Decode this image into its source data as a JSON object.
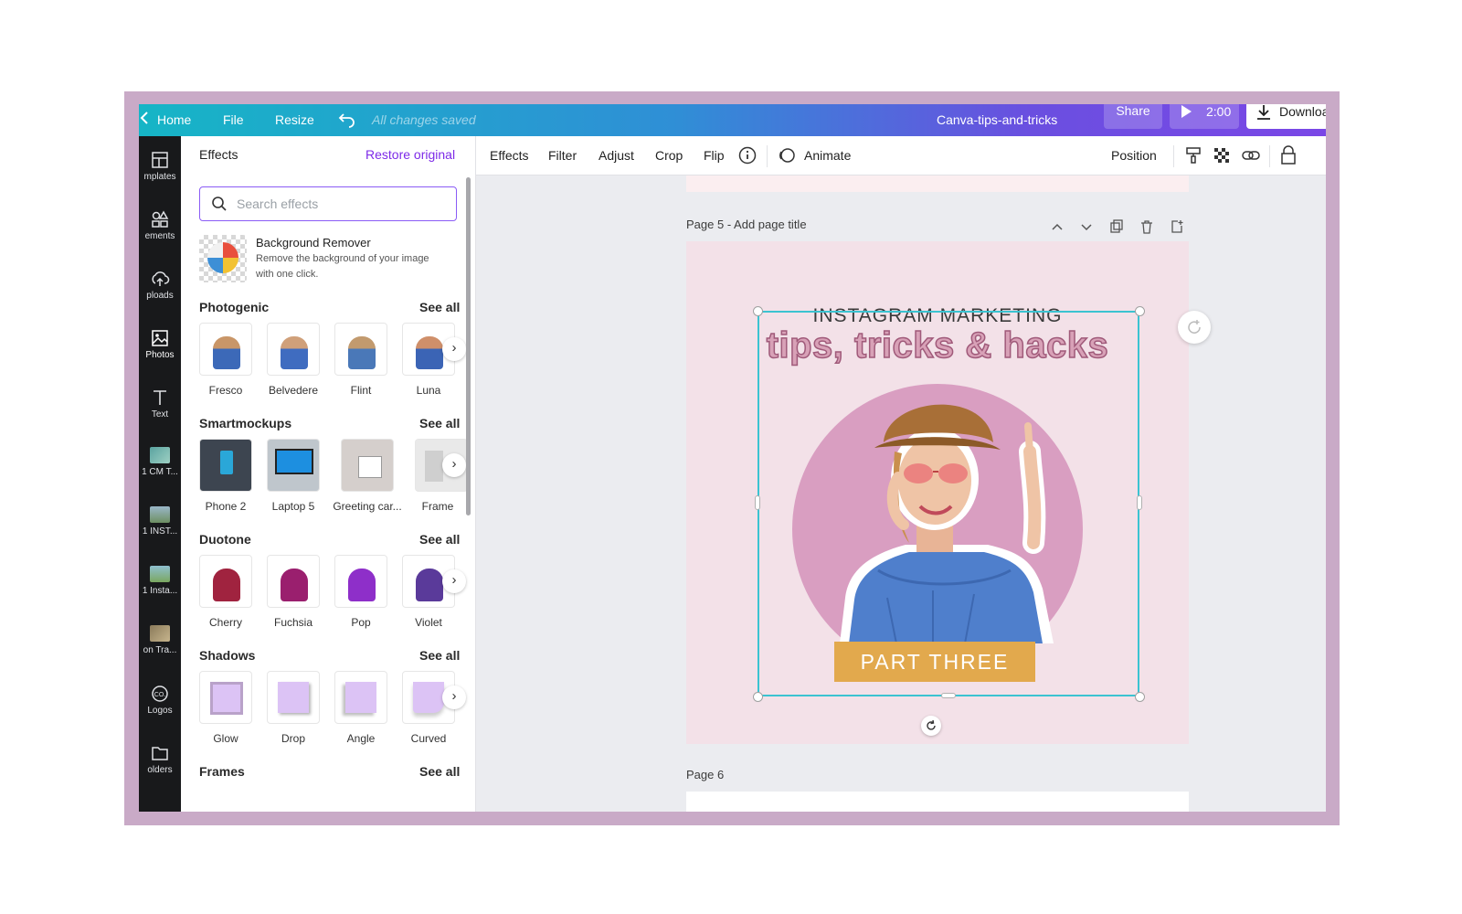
{
  "topbar": {
    "home": "Home",
    "file": "File",
    "resize": "Resize",
    "saved": "All changes saved",
    "design_title": "Canva-tips-and-tricks",
    "share": "Share",
    "play_time": "2:00",
    "download": "Download"
  },
  "rail": [
    {
      "label": "mplates",
      "icon": "templates-icon"
    },
    {
      "label": "ements",
      "icon": "elements-icon"
    },
    {
      "label": "ploads",
      "icon": "uploads-icon"
    },
    {
      "label": "Photos",
      "icon": "photos-icon"
    },
    {
      "label": "Text",
      "icon": "text-icon"
    },
    {
      "label": "1 CM T...",
      "icon": "folder-thumbnail"
    },
    {
      "label": "1 INST...",
      "icon": "folder-thumbnail"
    },
    {
      "label": "1 Insta...",
      "icon": "folder-thumbnail"
    },
    {
      "label": "on Tra...",
      "icon": "folder-thumbnail"
    },
    {
      "label": "Logos",
      "icon": "logos-icon"
    },
    {
      "label": "olders",
      "icon": "folders-icon"
    }
  ],
  "panel": {
    "title": "Effects",
    "restore": "Restore original",
    "search_placeholder": "Search effects",
    "bg_remover": {
      "title": "Background Remover",
      "desc_line1": "Remove the background of your image",
      "desc_line2": "with one click."
    },
    "see_all": "See all",
    "sections": [
      {
        "title": "Photogenic",
        "items": [
          "Fresco",
          "Belvedere",
          "Flint",
          "Luna"
        ]
      },
      {
        "title": "Smartmockups",
        "items": [
          "Phone 2",
          "Laptop 5",
          "Greeting car...",
          "Frame"
        ]
      },
      {
        "title": "Duotone",
        "items": [
          "Cherry",
          "Fuchsia",
          "Pop",
          "Violet"
        ]
      },
      {
        "title": "Shadows",
        "items": [
          "Glow",
          "Drop",
          "Angle",
          "Curved"
        ]
      },
      {
        "title": "Frames",
        "items": []
      }
    ]
  },
  "toolbar": {
    "effects": "Effects",
    "filter": "Filter",
    "adjust": "Adjust",
    "crop": "Crop",
    "flip": "Flip",
    "animate": "Animate",
    "position": "Position"
  },
  "canvas": {
    "page5_label": "Page 5 - Add page title",
    "page6_label": "Page 6",
    "headline_small": "INSTAGRAM MARKETING",
    "headline_big": "tips, tricks & hacks",
    "banner": "PART THREE"
  },
  "colors": {
    "accent_purple": "#8b5cf6",
    "selection": "#3bc3d1",
    "page_bg": "#f3e1e8",
    "circle": "#d99ec1",
    "banner": "#e2a94d"
  }
}
